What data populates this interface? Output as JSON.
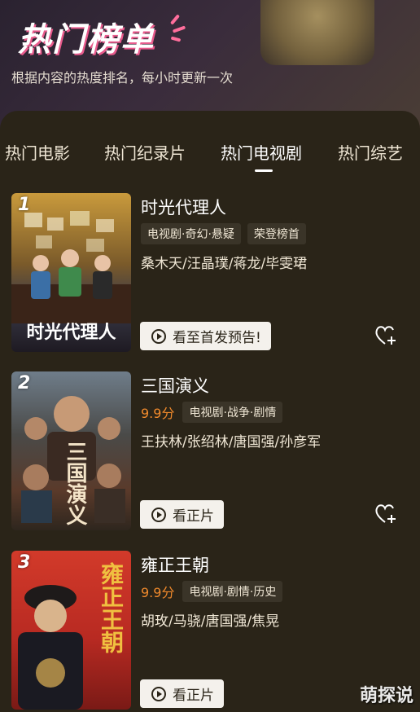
{
  "header": {
    "title": "热门榜单",
    "subtitle": "根据内容的热度排名，每小时更新一次"
  },
  "tabs": [
    {
      "label": "热门电影"
    },
    {
      "label": "热门纪录片"
    },
    {
      "label": "热门电视剧",
      "active": true
    },
    {
      "label": "热门综艺"
    }
  ],
  "items": [
    {
      "rank": "1",
      "title": "时光代理人",
      "poster_title": "时光代理人",
      "score": "",
      "tags": [
        "电视剧·奇幻·悬疑",
        "荣登榜首"
      ],
      "cast": "桑木天/汪晶璞/蒋龙/毕雯珺",
      "action": "看至首发预告!"
    },
    {
      "rank": "2",
      "title": "三国演义",
      "poster_title": "三国演义",
      "score": "9.9分",
      "tags": [
        "电视剧·战争·剧情"
      ],
      "cast": "王扶林/张绍林/唐国强/孙彦军",
      "action": "看正片"
    },
    {
      "rank": "3",
      "title": "雍正王朝",
      "poster_title": "雍正王朝",
      "score": "9.9分",
      "tags": [
        "电视剧·剧情·历史"
      ],
      "cast": "胡玫/马骁/唐国强/焦晃",
      "action": "看正片"
    }
  ],
  "watermark": "萌探说",
  "colors": {
    "background": "#2a2418",
    "score": "#f08a2c",
    "title_shadow": "#e85a8c"
  }
}
